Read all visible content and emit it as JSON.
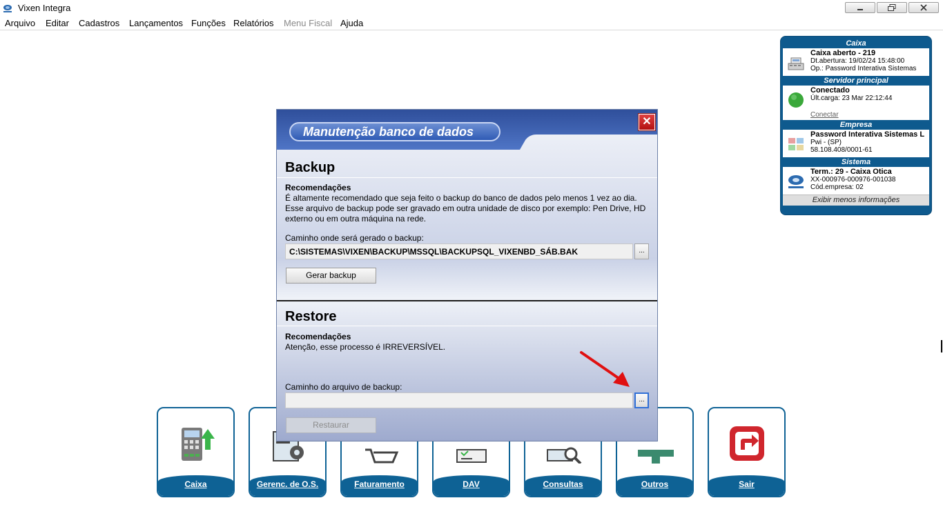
{
  "window": {
    "title": "Vixen Integra",
    "minimize_icon": "minimize-icon",
    "restore_icon": "restore-icon",
    "close_icon": "close-icon"
  },
  "menu": [
    "Arquivo",
    "Editar",
    "Cadastros",
    "Lançamentos",
    "Funções",
    "Relatórios",
    "Menu Fiscal",
    "Ajuda"
  ],
  "info_panel": {
    "caixa": {
      "header": "Caixa",
      "line1": "Caixa aberto - 219",
      "line2": "Dt.abertura: 19/02/24 15:48:00",
      "line3": "Op.: Password Interativa Sistemas"
    },
    "servidor": {
      "header": "Servidor principal",
      "line1": "Conectado",
      "line2": "Últ.carga: 23 Mar 22:12:44",
      "link": "Conectar"
    },
    "empresa": {
      "header": "Empresa",
      "line1": "Password Interativa Sistemas L",
      "line2": "Pwi - (SP)",
      "line3": "58.108.408/0001-61"
    },
    "sistema": {
      "header": "Sistema",
      "line1": "Term.: 29 - Caixa Otica",
      "line2": "XX-000976-000976-001038",
      "line3": "Cód.empresa: 02"
    },
    "footer": "Exibir menos informações"
  },
  "tiles": [
    "Caixa",
    "Gerenc. de O.S.",
    "Faturamento",
    "DAV",
    "Consultas",
    "Outros",
    "Sair"
  ],
  "dialog": {
    "title": "Manutenção banco de dados",
    "backup": {
      "title": "Backup",
      "rec_title": "Recomendações",
      "rec_text": "É altamente recomendado que seja feito o backup do banco de dados pelo menos 1 vez ao dia. Esse arquivo de backup pode ser gravado em outra unidade de disco por exemplo: Pen Drive, HD externo ou em outra máquina na rede.",
      "path_label": "Caminho onde será gerado o backup:",
      "path_value": "C:\\SISTEMAS\\VIXEN\\BACKUP\\MSSQL\\BACKUPSQL_VIXENBD_SÁB.BAK",
      "browse_label": "...",
      "button": "Gerar backup"
    },
    "restore": {
      "title": "Restore",
      "rec_title": "Recomendações",
      "rec_text": "Atenção, esse processo é IRREVERSÍVEL.",
      "path_label": "Caminho do arquivo de backup:",
      "path_value": "",
      "browse_label": "...",
      "button": "Restaurar"
    }
  },
  "colors": {
    "panel_blue": "#0e5a8e",
    "tile_blue": "#0e6295",
    "close_red": "#c41a1a",
    "arrow_red": "#e01010"
  }
}
